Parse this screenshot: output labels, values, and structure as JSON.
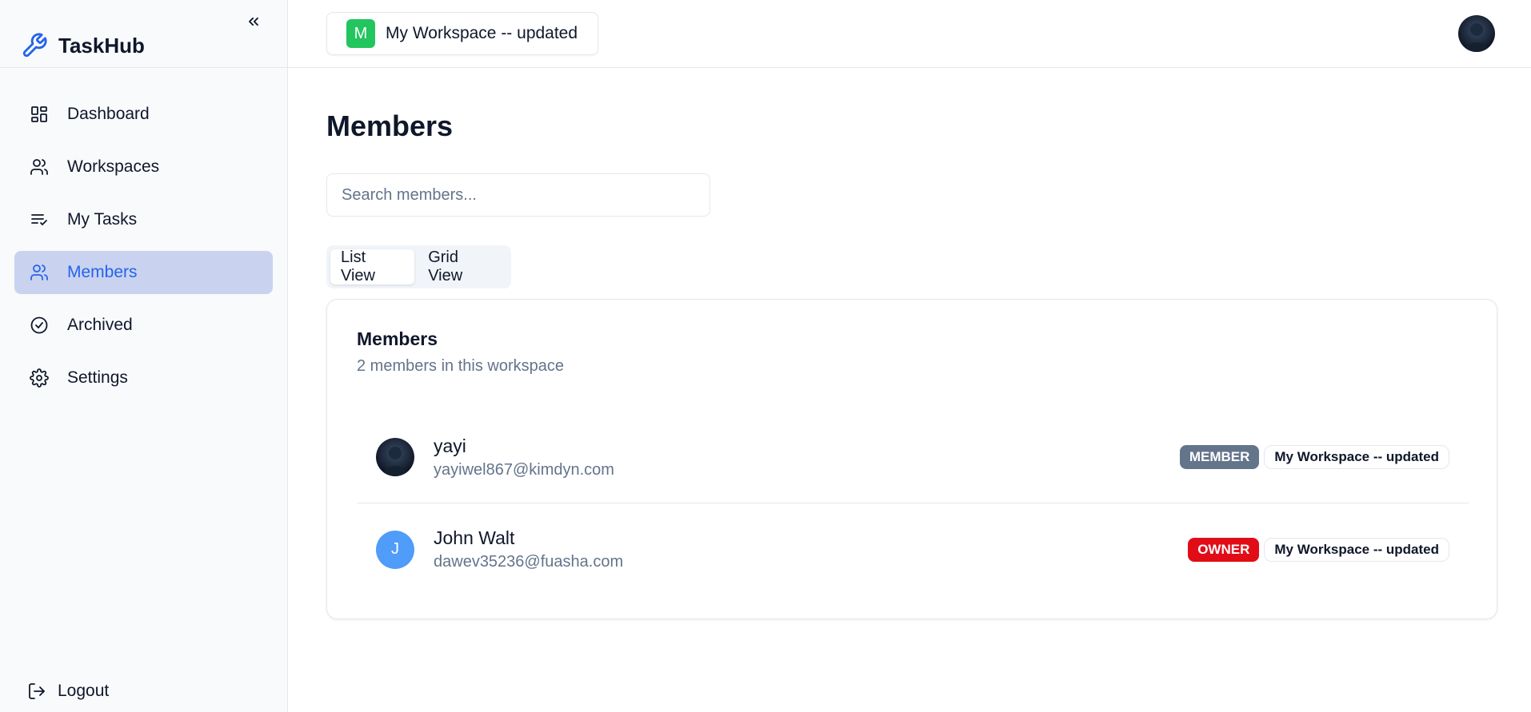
{
  "app": {
    "name": "TaskHub"
  },
  "sidebar": {
    "items": [
      {
        "label": "Dashboard",
        "icon": "dashboard-icon",
        "active": false
      },
      {
        "label": "Workspaces",
        "icon": "users-icon",
        "active": false
      },
      {
        "label": "My Tasks",
        "icon": "list-check-icon",
        "active": false
      },
      {
        "label": "Members",
        "icon": "users-icon",
        "active": true
      },
      {
        "label": "Archived",
        "icon": "check-circle-icon",
        "active": false
      },
      {
        "label": "Settings",
        "icon": "gear-icon",
        "active": false
      }
    ],
    "logout_label": "Logout"
  },
  "topbar": {
    "workspace_initial": "M",
    "workspace_name": "My Workspace -- updated",
    "workspace_color": "#22c55e"
  },
  "page": {
    "title": "Members",
    "search_placeholder": "Search members...",
    "tabs": [
      {
        "label": "List View",
        "active": true
      },
      {
        "label": "Grid View",
        "active": false
      }
    ]
  },
  "members_card": {
    "title": "Members",
    "subtitle": "2 members in this workspace",
    "members": [
      {
        "name": "yayi",
        "email": "yayiwel867@kimdyn.com",
        "avatar": "photo",
        "role": "MEMBER",
        "role_color": "#64748b",
        "workspace": "My Workspace -- updated"
      },
      {
        "name": "John Walt",
        "email": "dawev35236@fuasha.com",
        "avatar": "J",
        "role": "OWNER",
        "role_color": "#e20c17",
        "workspace": "My Workspace -- updated"
      }
    ]
  }
}
